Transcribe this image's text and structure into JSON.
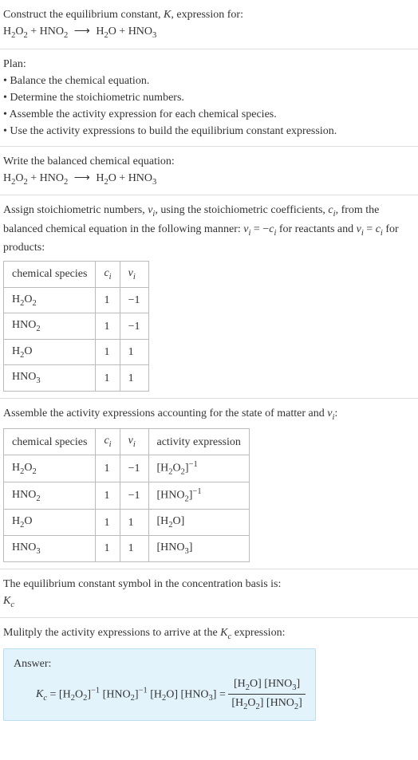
{
  "intro": {
    "line1": "Construct the equilibrium constant, K, expression for:",
    "equation": "H₂O₂ + HNO₂ ⟶ H₂O + HNO₃"
  },
  "plan": {
    "title": "Plan:",
    "b1": "• Balance the chemical equation.",
    "b2": "• Determine the stoichiometric numbers.",
    "b3": "• Assemble the activity expression for each chemical species.",
    "b4": "• Use the activity expressions to build the equilibrium constant expression."
  },
  "balanced": {
    "title": "Write the balanced chemical equation:",
    "equation": "H₂O₂ + HNO₂ ⟶ H₂O + HNO₃"
  },
  "assign": {
    "text": "Assign stoichiometric numbers, νᵢ, using the stoichiometric coefficients, cᵢ, from the balanced chemical equation in the following manner: νᵢ = −cᵢ for reactants and νᵢ = cᵢ for products:",
    "h1": "chemical species",
    "h2": "cᵢ",
    "h3": "νᵢ",
    "rows": [
      {
        "sp": "H₂O₂",
        "c": "1",
        "v": "−1"
      },
      {
        "sp": "HNO₂",
        "c": "1",
        "v": "−1"
      },
      {
        "sp": "H₂O",
        "c": "1",
        "v": "1"
      },
      {
        "sp": "HNO₃",
        "c": "1",
        "v": "1"
      }
    ]
  },
  "assemble": {
    "title": "Assemble the activity expressions accounting for the state of matter and νᵢ:",
    "h1": "chemical species",
    "h2": "cᵢ",
    "h3": "νᵢ",
    "h4": "activity expression",
    "rows": [
      {
        "sp": "H₂O₂",
        "c": "1",
        "v": "−1",
        "a": "[H₂O₂]⁻¹"
      },
      {
        "sp": "HNO₂",
        "c": "1",
        "v": "−1",
        "a": "[HNO₂]⁻¹"
      },
      {
        "sp": "H₂O",
        "c": "1",
        "v": "1",
        "a": "[H₂O]"
      },
      {
        "sp": "HNO₃",
        "c": "1",
        "v": "1",
        "a": "[HNO₃]"
      }
    ]
  },
  "symbol": {
    "line1": "The equilibrium constant symbol in the concentration basis is:",
    "line2": "K𝒸"
  },
  "multiply": {
    "title": "Mulitply the activity expressions to arrive at the K𝒸 expression:",
    "answer_label": "Answer:",
    "kc_expr": "K𝒸 = [H₂O₂]⁻¹ [HNO₂]⁻¹ [H₂O] [HNO₃] =",
    "frac_num": "[H₂O] [HNO₃]",
    "frac_den": "[H₂O₂] [HNO₂]"
  },
  "chart_data": null
}
